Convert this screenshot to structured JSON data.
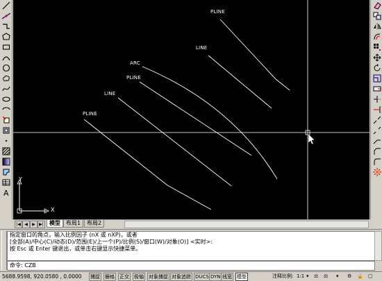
{
  "left_toolbar": {
    "icons": [
      "line-icon",
      "construction-line-icon",
      "polyline-icon",
      "polygon-icon",
      "rectangle-icon",
      "arc-icon",
      "circle-icon",
      "revcloud-icon",
      "spline-icon",
      "ellipse-icon",
      "ellipse-arc-icon",
      "insert-block-icon",
      "make-block-icon",
      "point-icon",
      "hatch-icon",
      "gradient-icon",
      "region-icon",
      "table-icon",
      "multiline-text-icon"
    ]
  },
  "right_toolbar": {
    "icons": [
      "erase-icon",
      "copy-icon",
      "mirror-icon",
      "offset-icon",
      "array-icon",
      "move-icon",
      "rotate-icon",
      "scale-icon",
      "stretch-icon",
      "trim-icon",
      "extend-icon",
      "break-at-point-icon",
      "break-icon",
      "join-icon",
      "chamfer-icon",
      "fillet-icon",
      "explode-icon"
    ]
  },
  "canvas": {
    "background": "#000000",
    "entity_labels": [
      "PLINE",
      "LINE",
      "ARC",
      "PLINE",
      "LINE",
      "PLINE"
    ],
    "ucs": {
      "y_label": "Y",
      "x_label": "X"
    }
  },
  "layout_tabs": {
    "nav": [
      "|◀",
      "◀",
      "▶",
      "▶|"
    ],
    "tabs": [
      "模型",
      "布局1",
      "布局2"
    ],
    "active": "模型"
  },
  "command_window": {
    "history": [
      "指定窗口的角点，输入比例因子 (nX 或 nXP)，或者",
      "[全部(A)/中心(C)/动态(D)/范围(E)/上一个(P)/比例(S)/窗口(W)/对象(O)] <实时>:",
      "按 Esc 或 Enter 键退出，或单击右键显示快捷菜单。"
    ],
    "prompt": "命令: CZB"
  },
  "statusbar": {
    "coords": "5688.9598, 920.0580 , 0.0000",
    "toggles": [
      {
        "label": "捕捉",
        "on": false
      },
      {
        "label": "栅格",
        "on": false
      },
      {
        "label": "正交",
        "on": false
      },
      {
        "label": "极轴",
        "on": false
      },
      {
        "label": "对象捕捉",
        "on": false
      },
      {
        "label": "对象追踪",
        "on": false
      },
      {
        "label": "DUCS",
        "on": false
      },
      {
        "label": "DYN",
        "on": false
      },
      {
        "label": "线宽",
        "on": false
      },
      {
        "label": "模型",
        "on": true
      }
    ],
    "annotation_scale_label": "注释比例:",
    "annotation_scale_value": "1:1"
  }
}
